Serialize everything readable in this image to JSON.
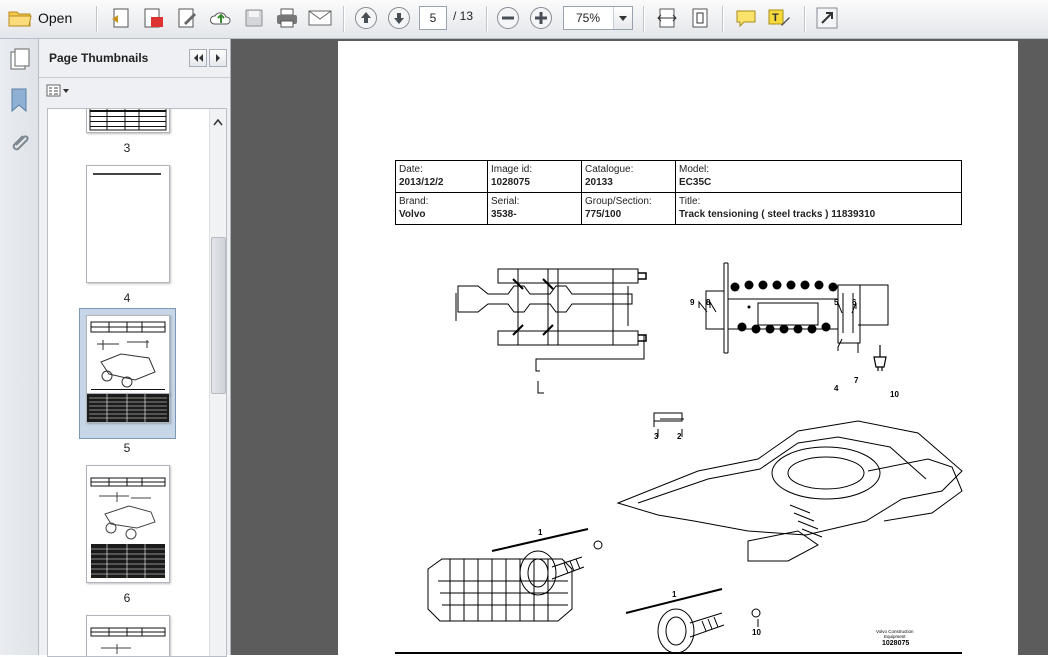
{
  "toolbar": {
    "open_label": "Open",
    "current_page": "5",
    "total_pages": "/ 13",
    "zoom": "75%"
  },
  "sidebar": {
    "title": "Page Thumbnails",
    "thumbnails": [
      {
        "label": "3"
      },
      {
        "label": "4"
      },
      {
        "label": "5"
      },
      {
        "label": "6"
      }
    ]
  },
  "document": {
    "header": {
      "date_label": "Date:",
      "date": "2013/12/2",
      "image_id_label": "Image id:",
      "image_id": "1028075",
      "catalogue_label": "Catalogue:",
      "catalogue": "20133",
      "model_label": "Model:",
      "model": "EC35C",
      "brand_label": "Brand:",
      "brand": "Volvo",
      "serial_label": "Serial:",
      "serial": "3538-",
      "group_label": "Group/Section:",
      "group": "775/100",
      "title_label": "Title:",
      "title": "Track tensioning ( steel tracks ) 11839310"
    },
    "callouts": [
      "9",
      "8",
      "5",
      "6",
      "4",
      "7",
      "10",
      "3",
      "2",
      "1",
      "1",
      "10"
    ],
    "stamp_line1": "Volvo Construction",
    "stamp_line2": "Equipment",
    "stamp_id": "1028075"
  }
}
